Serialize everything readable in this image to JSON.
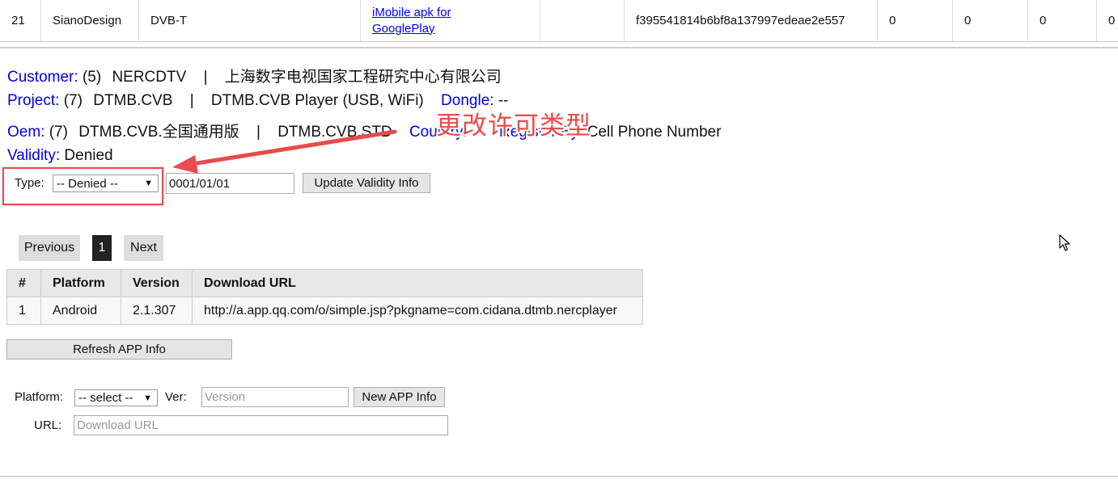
{
  "top_row": {
    "index": "21",
    "customer": "SianoDesign",
    "standard": "DVB-T",
    "app_link": "iMobile apk for GooglePlay",
    "hash": "f395541814b6bf8a137997edeae2e557",
    "c1": "0",
    "c2": "0",
    "c3": "0",
    "c4": "0"
  },
  "customer": {
    "label": "Customer:",
    "count": "(5)",
    "name": "NERCDTV",
    "sep": "|",
    "full_name": "上海数字电视国家工程研究中心有限公司"
  },
  "project": {
    "label": "Project:",
    "count": "(7)",
    "name": "DTMB.CVB",
    "sep": "|",
    "full_name": "DTMB.CVB Player (USB, WiFi)",
    "dongle_label": "Dongle:",
    "dongle_value": "--"
  },
  "oem": {
    "label": "Oem:",
    "count": "(7)",
    "name": "DTMB.CVB.全国通用版",
    "sep": "|",
    "full_name": "DTMB.CVB.STD",
    "country_label": "Country:",
    "country_value": "--",
    "register_label": "Register By:",
    "register_value": "Cell Phone Number"
  },
  "validity": {
    "label": "Validity:",
    "value": "Denied"
  },
  "validity_form": {
    "type_label": "Type:",
    "type_selected": "-- Denied --",
    "date_value": "0001/01/01",
    "update_button": "Update Validity Info"
  },
  "annotation": {
    "text": "更改许可类型",
    "color": "#e84b4b"
  },
  "pager": {
    "previous": "Previous",
    "current": "1",
    "next": "Next"
  },
  "apps_table": {
    "headers": [
      "#",
      "Platform",
      "Version",
      "Download URL"
    ],
    "rows": [
      [
        "1",
        "Android",
        "2.1.307",
        "http://a.app.qq.com/o/simple.jsp?pkgname=com.cidana.dtmb.nercplayer"
      ]
    ]
  },
  "refresh_button": "Refresh APP Info",
  "new_app_form": {
    "platform_label": "Platform:",
    "platform_selected": "-- select --",
    "ver_label": "Ver:",
    "ver_placeholder": "Version",
    "new_button": "New APP Info",
    "url_label": "URL:",
    "url_placeholder": "Download URL"
  },
  "colors": {
    "label_blue": "#0000dd",
    "link_blue": "#0000ee",
    "annotation_red": "#e84b4b"
  }
}
